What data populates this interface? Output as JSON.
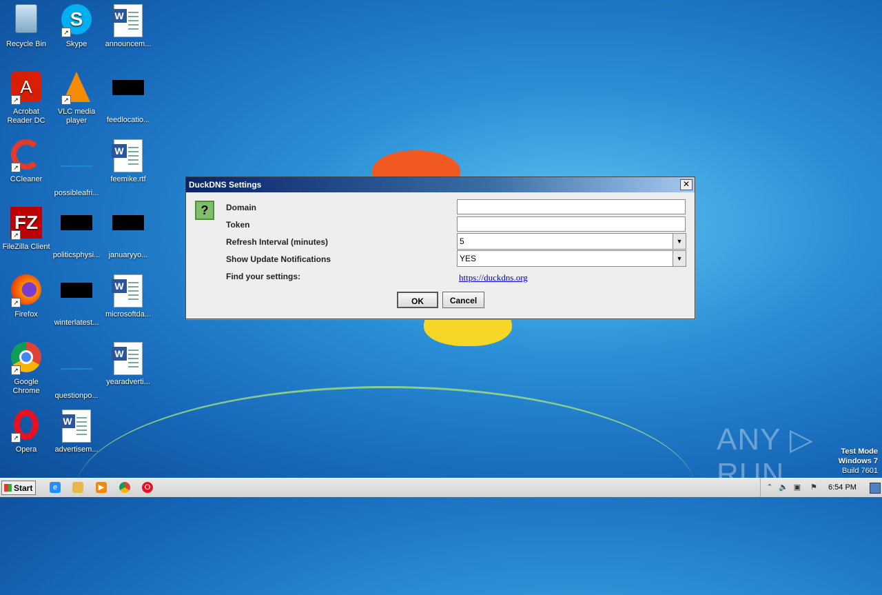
{
  "desktop": {
    "icons": [
      {
        "label": "Recycle Bin"
      },
      {
        "label": "Skype"
      },
      {
        "label": "announcem..."
      },
      {
        "label": "Acrobat Reader DC"
      },
      {
        "label": "VLC media player"
      },
      {
        "label": "feedlocatio..."
      },
      {
        "label": "CCleaner"
      },
      {
        "label": "possibleafri..."
      },
      {
        "label": "feemike.rtf"
      },
      {
        "label": "FileZilla Client"
      },
      {
        "label": "politicsphysi..."
      },
      {
        "label": "januaryyo..."
      },
      {
        "label": "Firefox"
      },
      {
        "label": "winterlatest..."
      },
      {
        "label": "microsoftda..."
      },
      {
        "label": "Google Chrome"
      },
      {
        "label": "questionpo..."
      },
      {
        "label": "yearadverti..."
      },
      {
        "label": "Opera"
      },
      {
        "label": "advertisem..."
      }
    ]
  },
  "dialog": {
    "title": "DuckDNS Settings",
    "close": "✕",
    "fields": {
      "domain_label": "Domain",
      "domain_value": "",
      "token_label": "Token",
      "token_value": "",
      "refresh_label": "Refresh Interval (minutes)",
      "refresh_value": "5",
      "notify_label": "Show Update Notifications",
      "notify_value": "YES",
      "find_label": "Find your settings:",
      "find_link": "https://duckdns.org"
    },
    "ok_label": "OK",
    "cancel_label": "Cancel"
  },
  "watermark": {
    "brand": "ANY ▷ RUN",
    "line1": "Test Mode",
    "line2": "Windows 7",
    "line3": "Build 7601"
  },
  "taskbar": {
    "start_label": "Start",
    "clock": "6:54 PM"
  }
}
